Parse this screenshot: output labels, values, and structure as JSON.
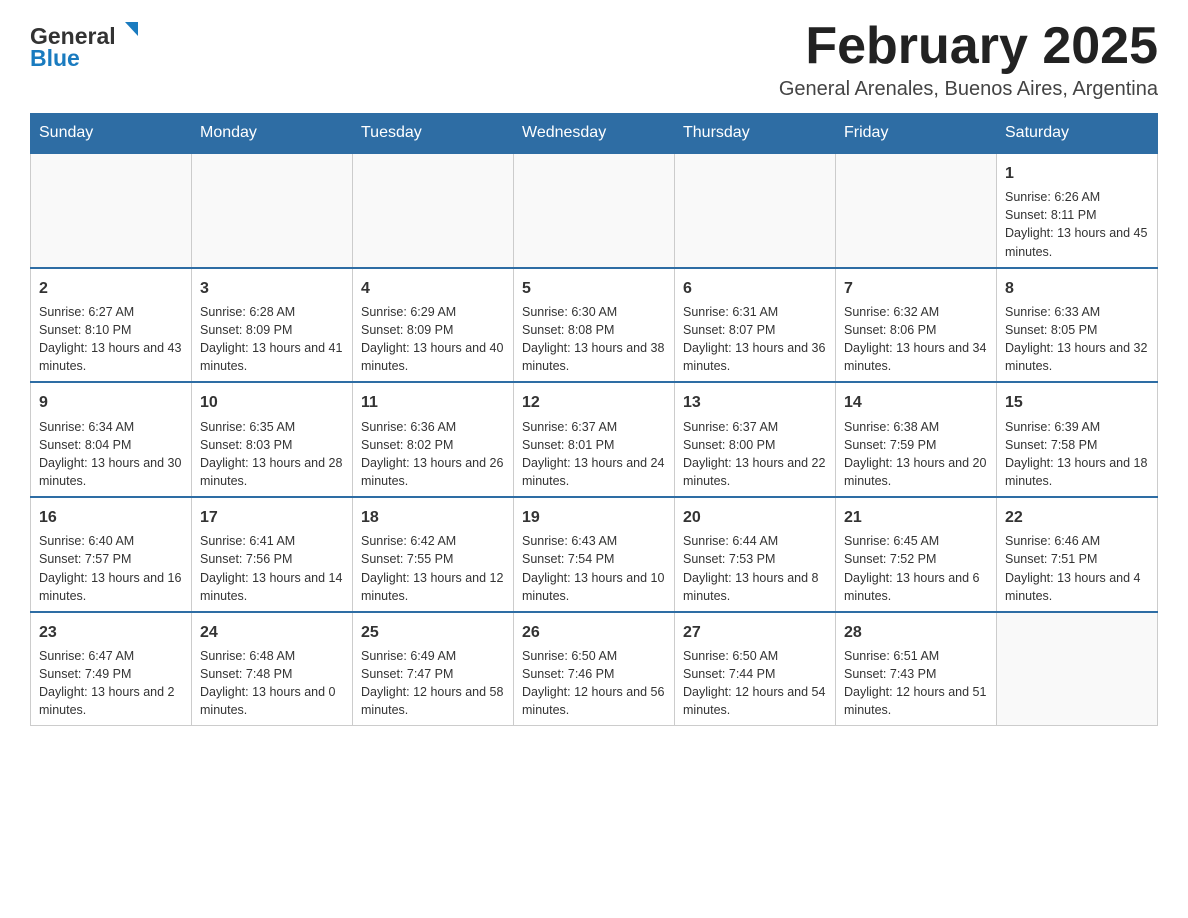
{
  "logo": {
    "text_general": "General",
    "text_blue": "Blue"
  },
  "title": "February 2025",
  "location": "General Arenales, Buenos Aires, Argentina",
  "weekdays": [
    "Sunday",
    "Monday",
    "Tuesday",
    "Wednesday",
    "Thursday",
    "Friday",
    "Saturday"
  ],
  "weeks": [
    [
      {
        "day": "",
        "sunrise": "",
        "sunset": "",
        "daylight": ""
      },
      {
        "day": "",
        "sunrise": "",
        "sunset": "",
        "daylight": ""
      },
      {
        "day": "",
        "sunrise": "",
        "sunset": "",
        "daylight": ""
      },
      {
        "day": "",
        "sunrise": "",
        "sunset": "",
        "daylight": ""
      },
      {
        "day": "",
        "sunrise": "",
        "sunset": "",
        "daylight": ""
      },
      {
        "day": "",
        "sunrise": "",
        "sunset": "",
        "daylight": ""
      },
      {
        "day": "1",
        "sunrise": "Sunrise: 6:26 AM",
        "sunset": "Sunset: 8:11 PM",
        "daylight": "Daylight: 13 hours and 45 minutes."
      }
    ],
    [
      {
        "day": "2",
        "sunrise": "Sunrise: 6:27 AM",
        "sunset": "Sunset: 8:10 PM",
        "daylight": "Daylight: 13 hours and 43 minutes."
      },
      {
        "day": "3",
        "sunrise": "Sunrise: 6:28 AM",
        "sunset": "Sunset: 8:09 PM",
        "daylight": "Daylight: 13 hours and 41 minutes."
      },
      {
        "day": "4",
        "sunrise": "Sunrise: 6:29 AM",
        "sunset": "Sunset: 8:09 PM",
        "daylight": "Daylight: 13 hours and 40 minutes."
      },
      {
        "day": "5",
        "sunrise": "Sunrise: 6:30 AM",
        "sunset": "Sunset: 8:08 PM",
        "daylight": "Daylight: 13 hours and 38 minutes."
      },
      {
        "day": "6",
        "sunrise": "Sunrise: 6:31 AM",
        "sunset": "Sunset: 8:07 PM",
        "daylight": "Daylight: 13 hours and 36 minutes."
      },
      {
        "day": "7",
        "sunrise": "Sunrise: 6:32 AM",
        "sunset": "Sunset: 8:06 PM",
        "daylight": "Daylight: 13 hours and 34 minutes."
      },
      {
        "day": "8",
        "sunrise": "Sunrise: 6:33 AM",
        "sunset": "Sunset: 8:05 PM",
        "daylight": "Daylight: 13 hours and 32 minutes."
      }
    ],
    [
      {
        "day": "9",
        "sunrise": "Sunrise: 6:34 AM",
        "sunset": "Sunset: 8:04 PM",
        "daylight": "Daylight: 13 hours and 30 minutes."
      },
      {
        "day": "10",
        "sunrise": "Sunrise: 6:35 AM",
        "sunset": "Sunset: 8:03 PM",
        "daylight": "Daylight: 13 hours and 28 minutes."
      },
      {
        "day": "11",
        "sunrise": "Sunrise: 6:36 AM",
        "sunset": "Sunset: 8:02 PM",
        "daylight": "Daylight: 13 hours and 26 minutes."
      },
      {
        "day": "12",
        "sunrise": "Sunrise: 6:37 AM",
        "sunset": "Sunset: 8:01 PM",
        "daylight": "Daylight: 13 hours and 24 minutes."
      },
      {
        "day": "13",
        "sunrise": "Sunrise: 6:37 AM",
        "sunset": "Sunset: 8:00 PM",
        "daylight": "Daylight: 13 hours and 22 minutes."
      },
      {
        "day": "14",
        "sunrise": "Sunrise: 6:38 AM",
        "sunset": "Sunset: 7:59 PM",
        "daylight": "Daylight: 13 hours and 20 minutes."
      },
      {
        "day": "15",
        "sunrise": "Sunrise: 6:39 AM",
        "sunset": "Sunset: 7:58 PM",
        "daylight": "Daylight: 13 hours and 18 minutes."
      }
    ],
    [
      {
        "day": "16",
        "sunrise": "Sunrise: 6:40 AM",
        "sunset": "Sunset: 7:57 PM",
        "daylight": "Daylight: 13 hours and 16 minutes."
      },
      {
        "day": "17",
        "sunrise": "Sunrise: 6:41 AM",
        "sunset": "Sunset: 7:56 PM",
        "daylight": "Daylight: 13 hours and 14 minutes."
      },
      {
        "day": "18",
        "sunrise": "Sunrise: 6:42 AM",
        "sunset": "Sunset: 7:55 PM",
        "daylight": "Daylight: 13 hours and 12 minutes."
      },
      {
        "day": "19",
        "sunrise": "Sunrise: 6:43 AM",
        "sunset": "Sunset: 7:54 PM",
        "daylight": "Daylight: 13 hours and 10 minutes."
      },
      {
        "day": "20",
        "sunrise": "Sunrise: 6:44 AM",
        "sunset": "Sunset: 7:53 PM",
        "daylight": "Daylight: 13 hours and 8 minutes."
      },
      {
        "day": "21",
        "sunrise": "Sunrise: 6:45 AM",
        "sunset": "Sunset: 7:52 PM",
        "daylight": "Daylight: 13 hours and 6 minutes."
      },
      {
        "day": "22",
        "sunrise": "Sunrise: 6:46 AM",
        "sunset": "Sunset: 7:51 PM",
        "daylight": "Daylight: 13 hours and 4 minutes."
      }
    ],
    [
      {
        "day": "23",
        "sunrise": "Sunrise: 6:47 AM",
        "sunset": "Sunset: 7:49 PM",
        "daylight": "Daylight: 13 hours and 2 minutes."
      },
      {
        "day": "24",
        "sunrise": "Sunrise: 6:48 AM",
        "sunset": "Sunset: 7:48 PM",
        "daylight": "Daylight: 13 hours and 0 minutes."
      },
      {
        "day": "25",
        "sunrise": "Sunrise: 6:49 AM",
        "sunset": "Sunset: 7:47 PM",
        "daylight": "Daylight: 12 hours and 58 minutes."
      },
      {
        "day": "26",
        "sunrise": "Sunrise: 6:50 AM",
        "sunset": "Sunset: 7:46 PM",
        "daylight": "Daylight: 12 hours and 56 minutes."
      },
      {
        "day": "27",
        "sunrise": "Sunrise: 6:50 AM",
        "sunset": "Sunset: 7:44 PM",
        "daylight": "Daylight: 12 hours and 54 minutes."
      },
      {
        "day": "28",
        "sunrise": "Sunrise: 6:51 AM",
        "sunset": "Sunset: 7:43 PM",
        "daylight": "Daylight: 12 hours and 51 minutes."
      },
      {
        "day": "",
        "sunrise": "",
        "sunset": "",
        "daylight": ""
      }
    ]
  ]
}
